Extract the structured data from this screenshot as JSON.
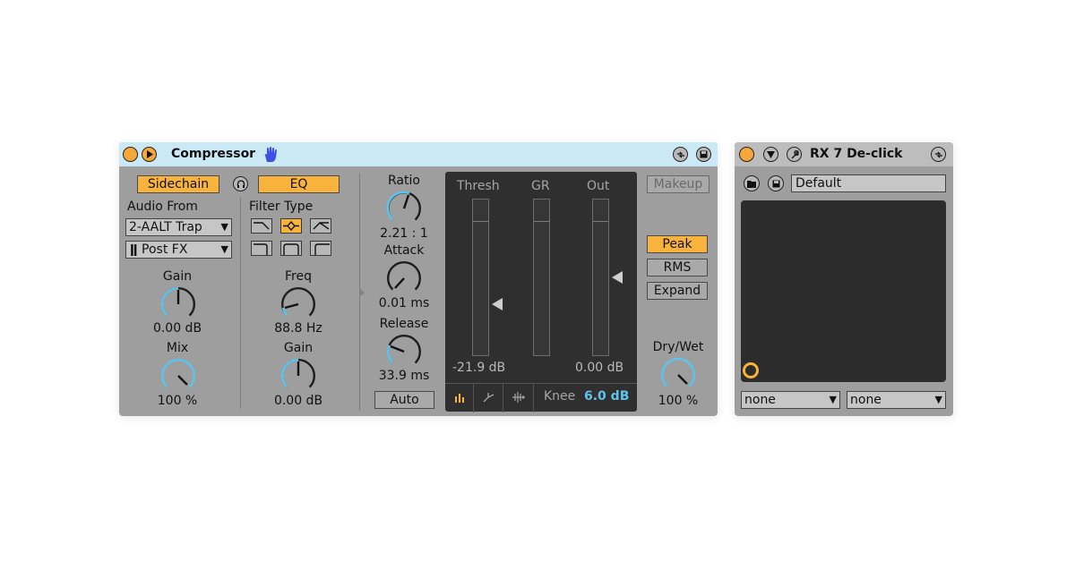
{
  "compressor": {
    "title": "Compressor",
    "sidechain_label": "Sidechain",
    "eq_label": "EQ",
    "audio_from_label": "Audio From",
    "audio_from_value": "2-AALT Trap",
    "post_fx_value": "Post FX",
    "gain_label": "Gain",
    "gain_value": "0.00 dB",
    "mix_label": "Mix",
    "mix_value": "100 %",
    "filter_type_label": "Filter Type",
    "freq_label": "Freq",
    "freq_value": "88.8 Hz",
    "eq_gain_label": "Gain",
    "eq_gain_value": "0.00 dB",
    "ratio_label": "Ratio",
    "ratio_value": "2.21 : 1",
    "attack_label": "Attack",
    "attack_value": "0.01 ms",
    "release_label": "Release",
    "release_value": "33.9 ms",
    "auto_label": "Auto",
    "meters": {
      "thresh_label": "Thresh",
      "gr_label": "GR",
      "out_label": "Out",
      "thresh_value": "-21.9 dB",
      "out_value": "0.00 dB",
      "knee_label": "Knee",
      "knee_value": "6.0 dB"
    },
    "makeup_label": "Makeup",
    "peak_label": "Peak",
    "rms_label": "RMS",
    "expand_label": "Expand",
    "drywet_label": "Dry/Wet",
    "drywet_value": "100 %"
  },
  "rx": {
    "title": "RX 7 De-click",
    "preset_value": "Default",
    "x_select_value": "none",
    "y_select_value": "none"
  },
  "colors": {
    "accent_orange": "#f7b33b",
    "knob_blue": "#5ec3ea",
    "title_bar_blue": "#cbe9f5",
    "device_grey": "#9e9e9e",
    "meter_bg": "#2f2f2f",
    "knee_value_blue": "#5ec3ea"
  }
}
